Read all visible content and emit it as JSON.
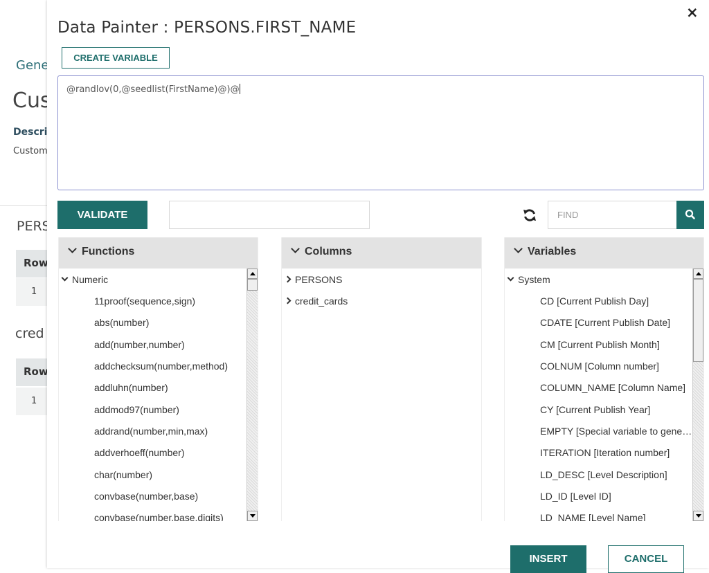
{
  "background": {
    "gene": "Gene",
    "cus": "Cus",
    "descr": "Descri",
    "custom": "Custom",
    "pers": "PERS",
    "cred": "cred",
    "row_header": "Row",
    "row_value": "1"
  },
  "modal": {
    "title": "Data Painter : PERSONS.FIRST_NAME",
    "close_label": "×",
    "create_variable_label": "CREATE VARIABLE",
    "expression": "@randlov(0,@seedlist(FirstName)@)@",
    "validate_label": "VALIDATE",
    "validate_value": "",
    "find_placeholder": "FIND",
    "insert_label": "INSERT",
    "cancel_label": "CANCEL"
  },
  "functions": {
    "header": "Functions",
    "group": "Numeric",
    "items": [
      "11proof(sequence,sign)",
      "abs(number)",
      "add(number,number)",
      "addchecksum(number,method)",
      "addluhn(number)",
      "addmod97(number)",
      "addrand(number,min,max)",
      "addverhoeff(number)",
      "char(number)",
      "convbase(number,base)",
      "convbase(number,base,digits)"
    ]
  },
  "columns": {
    "header": "Columns",
    "items": [
      "PERSONS",
      "credit_cards"
    ]
  },
  "variables": {
    "header": "Variables",
    "group": "System",
    "items": [
      "CD [Current Publish Day]",
      "CDATE [Current Publish Date]",
      "CM [Current Publish Month]",
      "COLNUM [Column number]",
      "COLUMN_NAME [Column Name]",
      "CY [Current Publish Year]",
      "EMPTY [Special variable to generate empty value]",
      "ITERATION [Iteration number]",
      "LD_DESC [Level Description]",
      "LD_ID [Level ID]",
      "LD_NAME [Level Name]"
    ]
  }
}
